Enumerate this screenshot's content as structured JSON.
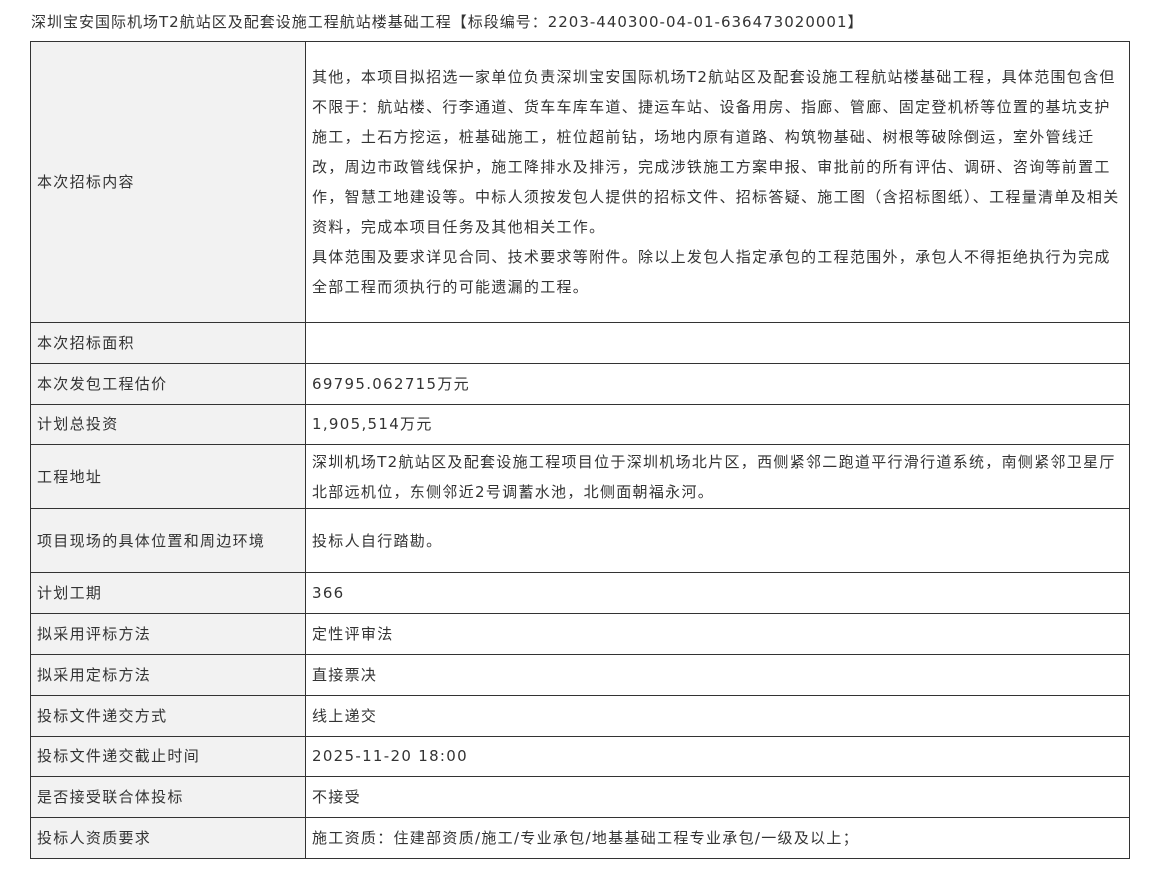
{
  "title": "深圳宝安国际机场T2航站区及配套设施工程航站楼基础工程【标段编号：2203-440300-04-01-636473020001】",
  "rows": [
    {
      "label": "本次招标内容",
      "value": "其他，本项目拟招选一家单位负责深圳宝安国际机场T2航站区及配套设施工程航站楼基础工程，具体范围包含但不限于：航站楼、行李通道、货车车库车道、捷运车站、设备用房、指廊、管廊、固定登机桥等位置的基坑支护施工，土石方挖运，桩基础施工，桩位超前钻，场地内原有道路、构筑物基础、树根等破除倒运，室外管线迁改，周边市政管线保护，施工降排水及排污，完成涉铁施工方案申报、审批前的所有评估、调研、咨询等前置工作，智慧工地建设等。中标人须按发包人提供的招标文件、招标答疑、施工图（含招标图纸）、工程量清单及相关资料，完成本项目任务及其他相关工作。",
      "value2": "具体范围及要求详见合同、技术要求等附件。除以上发包人指定承包的工程范围外，承包人不得拒绝执行为完成全部工程而须执行的可能遗漏的工程。"
    },
    {
      "label": "本次招标面积",
      "value": ""
    },
    {
      "label": "本次发包工程估价",
      "value": "69795.062715万元"
    },
    {
      "label": "计划总投资",
      "value": "1,905,514万元"
    },
    {
      "label": "工程地址",
      "value": "深圳机场T2航站区及配套设施工程项目位于深圳机场北片区，西侧紧邻二跑道平行滑行道系统，南侧紧邻卫星厅北部远机位，东侧邻近2号调蓄水池，北侧面朝福永河。"
    },
    {
      "label": "项目现场的具体位置和周边环境",
      "value": "投标人自行踏勘。"
    },
    {
      "label": "计划工期",
      "value": "366"
    },
    {
      "label": "拟采用评标方法",
      "value": "定性评审法"
    },
    {
      "label": "拟采用定标方法",
      "value": "直接票决"
    },
    {
      "label": "投标文件递交方式",
      "value": "线上递交"
    },
    {
      "label": "投标文件递交截止时间",
      "value": "2025-11-20 18:00"
    },
    {
      "label": "是否接受联合体投标",
      "value": "不接受"
    },
    {
      "label": "投标人资质要求",
      "value": "施工资质：住建部资质/施工/专业承包/地基基础工程专业承包/一级及以上；"
    }
  ]
}
